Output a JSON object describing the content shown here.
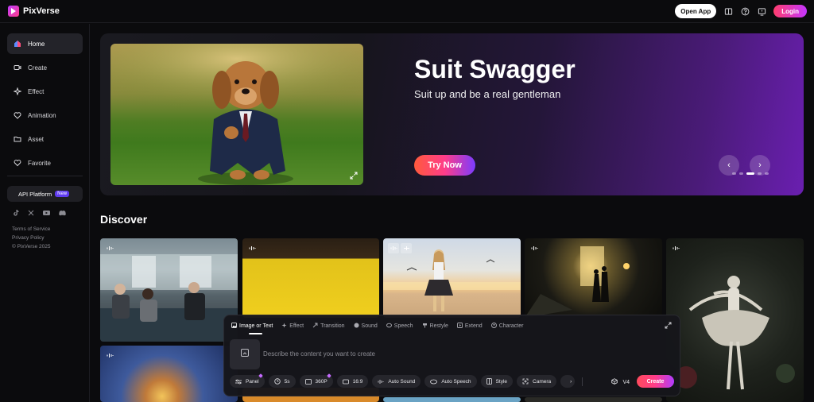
{
  "brand": {
    "name": "PixVerse"
  },
  "topbar": {
    "open_app": "Open App",
    "login": "Login"
  },
  "sidebar": {
    "items": [
      {
        "label": "Home",
        "icon": "home-icon"
      },
      {
        "label": "Create",
        "icon": "video-camera-icon"
      },
      {
        "label": "Effect",
        "icon": "sparkle-icon"
      },
      {
        "label": "Animation",
        "icon": "heart-face-icon"
      },
      {
        "label": "Asset",
        "icon": "folder-icon"
      },
      {
        "label": "Favorite",
        "icon": "heart-icon"
      }
    ],
    "api_label": "API Platform",
    "api_badge": "New",
    "footer": {
      "terms": "Terms of Service",
      "privacy": "Privacy Policy",
      "copyright": "© PixVerse 2025"
    }
  },
  "hero": {
    "title": "Suit Swagger",
    "subtitle": "Suit up and be a real gentleman",
    "cta": "Try Now",
    "prev": "‹",
    "next": "›"
  },
  "discover": {
    "heading": "Discover"
  },
  "create_panel": {
    "tabs": [
      "Image or Text",
      "Effect",
      "Transition",
      "Sound",
      "Speech",
      "Restyle",
      "Extend",
      "Character"
    ],
    "placeholder": "Describe the content you want to create",
    "chips": {
      "panel": "Panel",
      "duration": "5s",
      "quality": "360P",
      "ratio": "16:9",
      "auto_sound": "Auto Sound",
      "auto_speech": "Auto Speech",
      "style": "Style",
      "camera": "Camera",
      "more": "›"
    },
    "model": "V4",
    "create": "Create"
  },
  "colors": {
    "accent_pink": "#ff3d8a",
    "accent_purple": "#7b3cff",
    "background": "#0b0b0d"
  }
}
